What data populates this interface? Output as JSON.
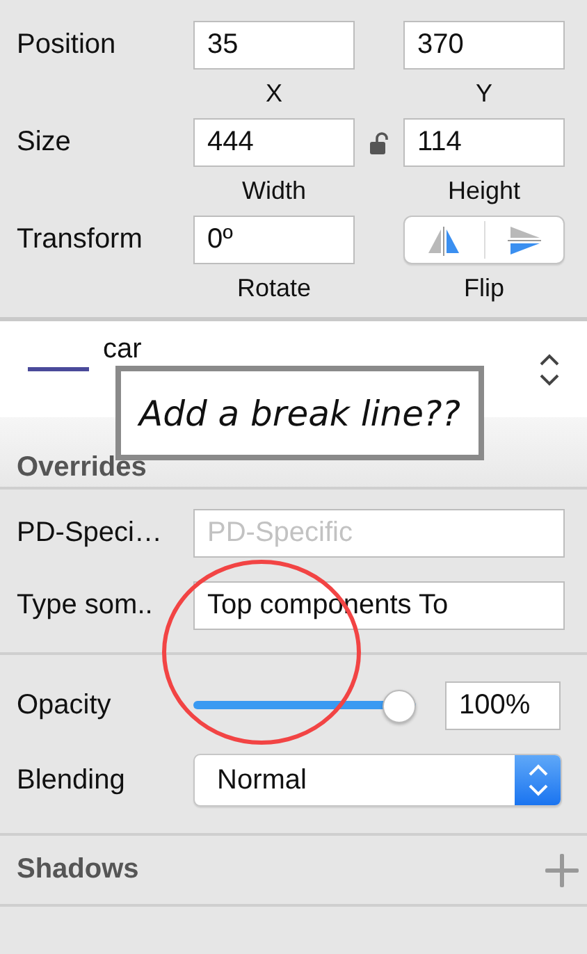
{
  "geometry": {
    "rows": [
      {
        "kind": "pair",
        "label": "Position",
        "fields": [
          {
            "value": "35",
            "caption": "X"
          },
          {
            "value": "370",
            "caption": "Y"
          }
        ]
      },
      {
        "kind": "pair",
        "label": "Size",
        "locked": false,
        "fields": [
          {
            "value": "444",
            "caption": "Width"
          },
          {
            "value": "114",
            "caption": "Height"
          }
        ]
      },
      {
        "kind": "transform",
        "label": "Transform",
        "field": {
          "value": "0º",
          "caption": "Rotate"
        },
        "flip": {
          "caption": "Flip"
        }
      }
    ]
  },
  "symbol": {
    "name": "car"
  },
  "callout": {
    "text": "Add a break line??"
  },
  "overrides": {
    "title": "Overrides",
    "fields": [
      {
        "label": "PD-Speci…",
        "placeholder": "PD-Specific"
      },
      {
        "label": "Type som..",
        "value": "Top components To"
      }
    ]
  },
  "opacity": {
    "label": "Opacity",
    "level": 1,
    "value": "100%"
  },
  "blending": {
    "label": "Blending",
    "value": "Normal"
  },
  "shadows": {
    "title": "Shadows"
  }
}
